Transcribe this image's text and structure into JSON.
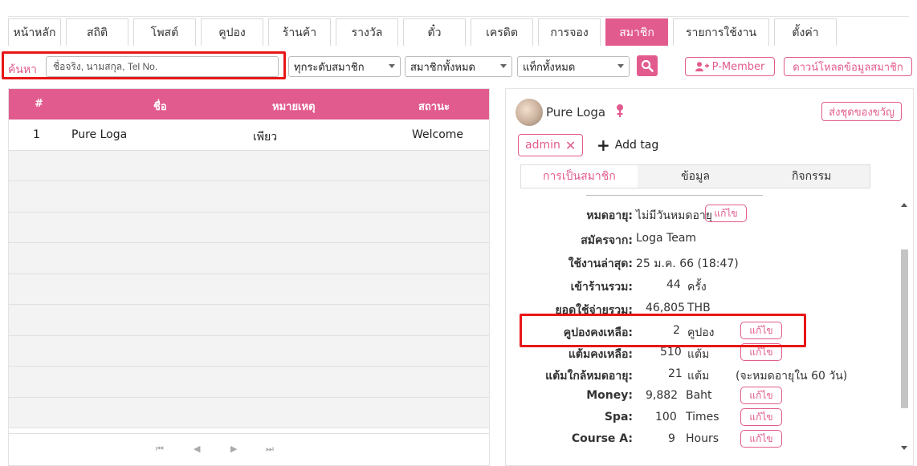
{
  "tabs": [
    "หน้าหลัก",
    "สถิติ",
    "โพสต์",
    "คูปอง",
    "ร้านค้า",
    "รางวัล",
    "ตั๋ว",
    "เครดิต",
    "การจอง",
    "สมาชิก",
    "รายการใช้งาน",
    "ตั้งค่า"
  ],
  "active_tab": "สมาชิก",
  "search": {
    "label": "ค้นหา",
    "placeholder": "ชื่อจริง, นามสกุล, Tel No.",
    "filter_level": "ทุกระดับสมาชิก",
    "filter_members": "สมาชิกทั้งหมด",
    "filter_tags": "แท็กทั้งหมด",
    "pmember_label": "P-Member",
    "download_label": "ดาวน์โหลดข้อมูลสมาชิก"
  },
  "table": {
    "headers": [
      "#",
      "ชื่อ",
      "หมายเหตุ",
      "สถานะ"
    ],
    "rows": [
      {
        "num": "1",
        "name": "Pure Loga",
        "note": "เพียว",
        "status": "Welcome"
      }
    ],
    "pager": [
      "⏮",
      "◀",
      "▶",
      "⏭"
    ]
  },
  "member": {
    "name": "Pure Loga",
    "gift_label": "ส่งชุดของขวัญ",
    "tag": "admin",
    "add_tag_label": "Add tag",
    "subtabs": [
      "การเป็นสมาชิก",
      "ข้อมูล",
      "กิจกรรม"
    ],
    "active_subtab": "การเป็นสมาชิก",
    "edit_label": "แก้ไข",
    "details": [
      {
        "label": "หมดอายุ:",
        "value": "ไม่มีวันหมดอายุ",
        "unit": "",
        "extra": "",
        "edit": true
      },
      {
        "label": "สมัครจาก:",
        "value": "Loga Team",
        "unit": "",
        "extra": "",
        "edit": false
      },
      {
        "label": "ใช้งานล่าสุด:",
        "value": "25 ม.ค. 66 (18:47)",
        "unit": "",
        "extra": "",
        "edit": false
      },
      {
        "label": "เข้าร้านรวม:",
        "value": "44",
        "unit": "ครั้ง",
        "extra": "",
        "edit": false
      },
      {
        "label": "ยอดใช้จ่ายรวม:",
        "value": "46,805",
        "unit": "THB",
        "extra": "",
        "edit": false
      },
      {
        "label": "คูปองคงเหลือ:",
        "value": "2",
        "unit": "คูปอง",
        "extra": "",
        "edit": true
      },
      {
        "label": "แต้มคงเหลือ:",
        "value": "510",
        "unit": "แต้ม",
        "extra": "",
        "edit": true
      },
      {
        "label": "แต้มใกล้หมดอายุ:",
        "value": "21",
        "unit": "แต้ม",
        "extra": "(จะหมดอายุใน 60 วัน)",
        "edit": false
      },
      {
        "label": "Money:",
        "value": "9,882",
        "unit": "Baht",
        "extra": "",
        "edit": true
      },
      {
        "label": "Spa:",
        "value": "100",
        "unit": "Times",
        "extra": "",
        "edit": true
      },
      {
        "label": "Course A:",
        "value": "9",
        "unit": "Hours",
        "extra": "",
        "edit": true
      }
    ]
  },
  "colors": {
    "accent": "#e25b8e",
    "highlight": "#e81717"
  }
}
